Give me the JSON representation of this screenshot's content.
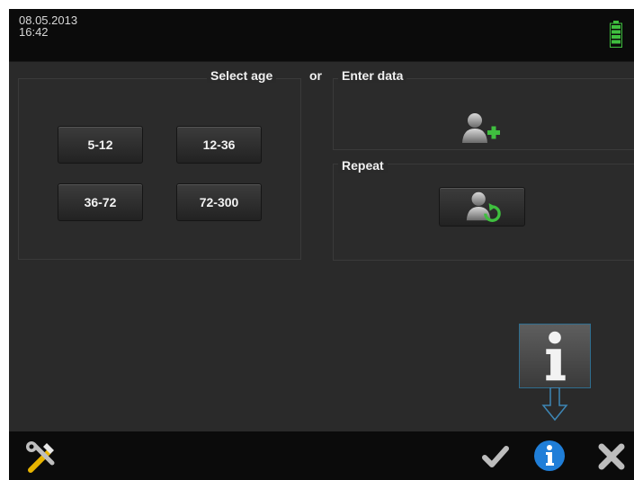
{
  "status": {
    "date": "08.05.2013",
    "time": "16:42"
  },
  "labels": {
    "select_age": "Select age",
    "or": "or",
    "enter_data": "Enter data",
    "repeat": "Repeat"
  },
  "age_buttons": [
    {
      "label": "5-12"
    },
    {
      "label": "12-36"
    },
    {
      "label": "36-72"
    },
    {
      "label": "72-300"
    }
  ],
  "icons": {
    "battery": "battery-full-icon",
    "add_user": "add-user-icon",
    "repeat_user": "repeat-user-icon",
    "info_large": "info-icon",
    "tools": "tools-icon",
    "check": "check-icon",
    "info": "info-circle-icon",
    "close": "close-icon"
  },
  "colors": {
    "accent_green": "#3fbf3f",
    "accent_blue": "#1f7ed8",
    "background": "#2a2a2a",
    "bar": "#0b0b0b"
  }
}
